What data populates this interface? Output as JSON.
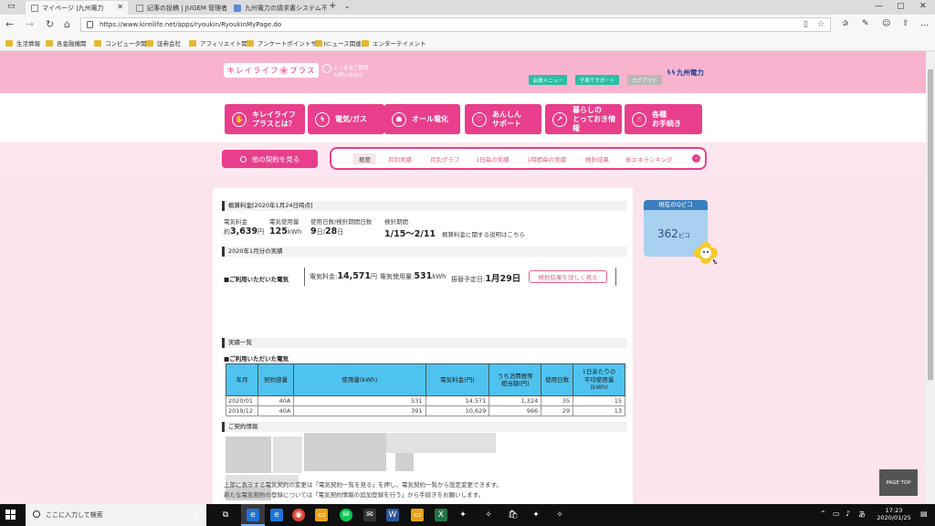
{
  "browser": {
    "tabs": [
      {
        "title": "マイページ |九州電力"
      },
      {
        "title": "記事の投稿 | JUGEM 管理者"
      },
      {
        "title": "九州電力の請求書システム不"
      }
    ],
    "url": "https://www.kireilife.net/apps/ryoukin/RyoukinMyPage.do",
    "favorites": [
      "生活情報",
      "各金融機関",
      "コンピュータ関連",
      "証券会社",
      "アフィリエイト関連",
      "アンケートポイントサイト",
      "ニュース関連",
      "エンターテイメント"
    ]
  },
  "header": {
    "logo": "キレイライフ🌸プラス",
    "logo_sub1": "よくあるご質問",
    "logo_sub2": "お問い合わせ",
    "btn_member_menu": "会員メニュー",
    "btn_help": "子育てサポート",
    "btn_logout": "ログアウト",
    "company": "九州電力"
  },
  "megamenu": [
    {
      "label1": "キレイライフ",
      "label2": "プラスとは？",
      "icon": "✋"
    },
    {
      "label1": "電気/ガス",
      "label2": "",
      "icon": "ϟ"
    },
    {
      "label1": "オール電化",
      "label2": "",
      "icon": "☗"
    },
    {
      "label1": "あんしん",
      "label2": "サポート",
      "icon": "♡"
    },
    {
      "label1": "暮らしの",
      "label2": "とっておき情報",
      "icon": "↗"
    },
    {
      "label1": "各種",
      "label2": "お手続き",
      "icon": "☝"
    }
  ],
  "subnav": {
    "other_contract": "他の契約を見る",
    "items": [
      "概要",
      "月別実績",
      "月別グラフ",
      "1日毎の実績",
      "1時間毎の実績",
      "検針結果",
      "省エネランキング"
    ]
  },
  "estimate": {
    "heading": "概算料金[2020年1月24日時点]",
    "label_fee": "電気料金",
    "label_usage": "電気使用量",
    "label_days": "使用日数/検針期間日数",
    "label_period": "検針期間",
    "fee_prefix": "約",
    "fee_value": "3,639",
    "fee_unit": "円",
    "usage_value": "125",
    "usage_unit": "kWh",
    "days_used": "9",
    "days_unit1": "日/",
    "days_total": "28",
    "days_unit2": "日",
    "period_value": "1/15～2/11",
    "period_note": "概算料金に関する説明はこちら"
  },
  "monthly": {
    "heading": "2020年1月分の実績",
    "label": "■ご利用いただいた電気",
    "fee_label": "電気料金:",
    "fee_value": "14,571",
    "fee_unit": "円",
    "usage_label": "電気使用量:",
    "usage_value": "531",
    "usage_unit": "kWh",
    "debit_label": "振替予定日:",
    "debit_value": "1月29日",
    "detail_button": "検針結果を詳しく見る"
  },
  "history": {
    "heading": "実績一覧",
    "label": "■ご利用いただいた電気",
    "columns": [
      "年月",
      "契約容量",
      "使用量(kWh)",
      "電気料金(円)",
      "うち消費税等\n相当額(円)",
      "使用日数",
      "1日あたりの\n平均使用量\n(kWh)"
    ],
    "rows": [
      [
        "2020/01",
        "40A",
        "531",
        "14,571",
        "1,324",
        "35",
        "15"
      ],
      [
        "2019/12",
        "40A",
        "391",
        "10,629",
        "966",
        "29",
        "13"
      ]
    ]
  },
  "contract": {
    "heading": "ご契約情報",
    "note1": "上部に表示する電気契約の変更は「電気契約一覧を見る」を押し、電気契約一覧から設定変更できます。",
    "note2": "新たな電気契約の登録については「電気契約情報の追加登録を行う」から手続きをお願いします。"
  },
  "qpico": {
    "title": "現在のQピコ",
    "value": "362",
    "unit": "ピコ"
  },
  "page_top": "PAGE TOP",
  "taskbar": {
    "search_placeholder": "ここに入力して検索",
    "time": "17:23",
    "date": "2020/01/25"
  },
  "colors": {
    "brand_pink": "#e83e8c",
    "header_pink": "#f8b4cf",
    "table_header": "#4fc3f0",
    "company_blue": "#1b3e9a"
  }
}
